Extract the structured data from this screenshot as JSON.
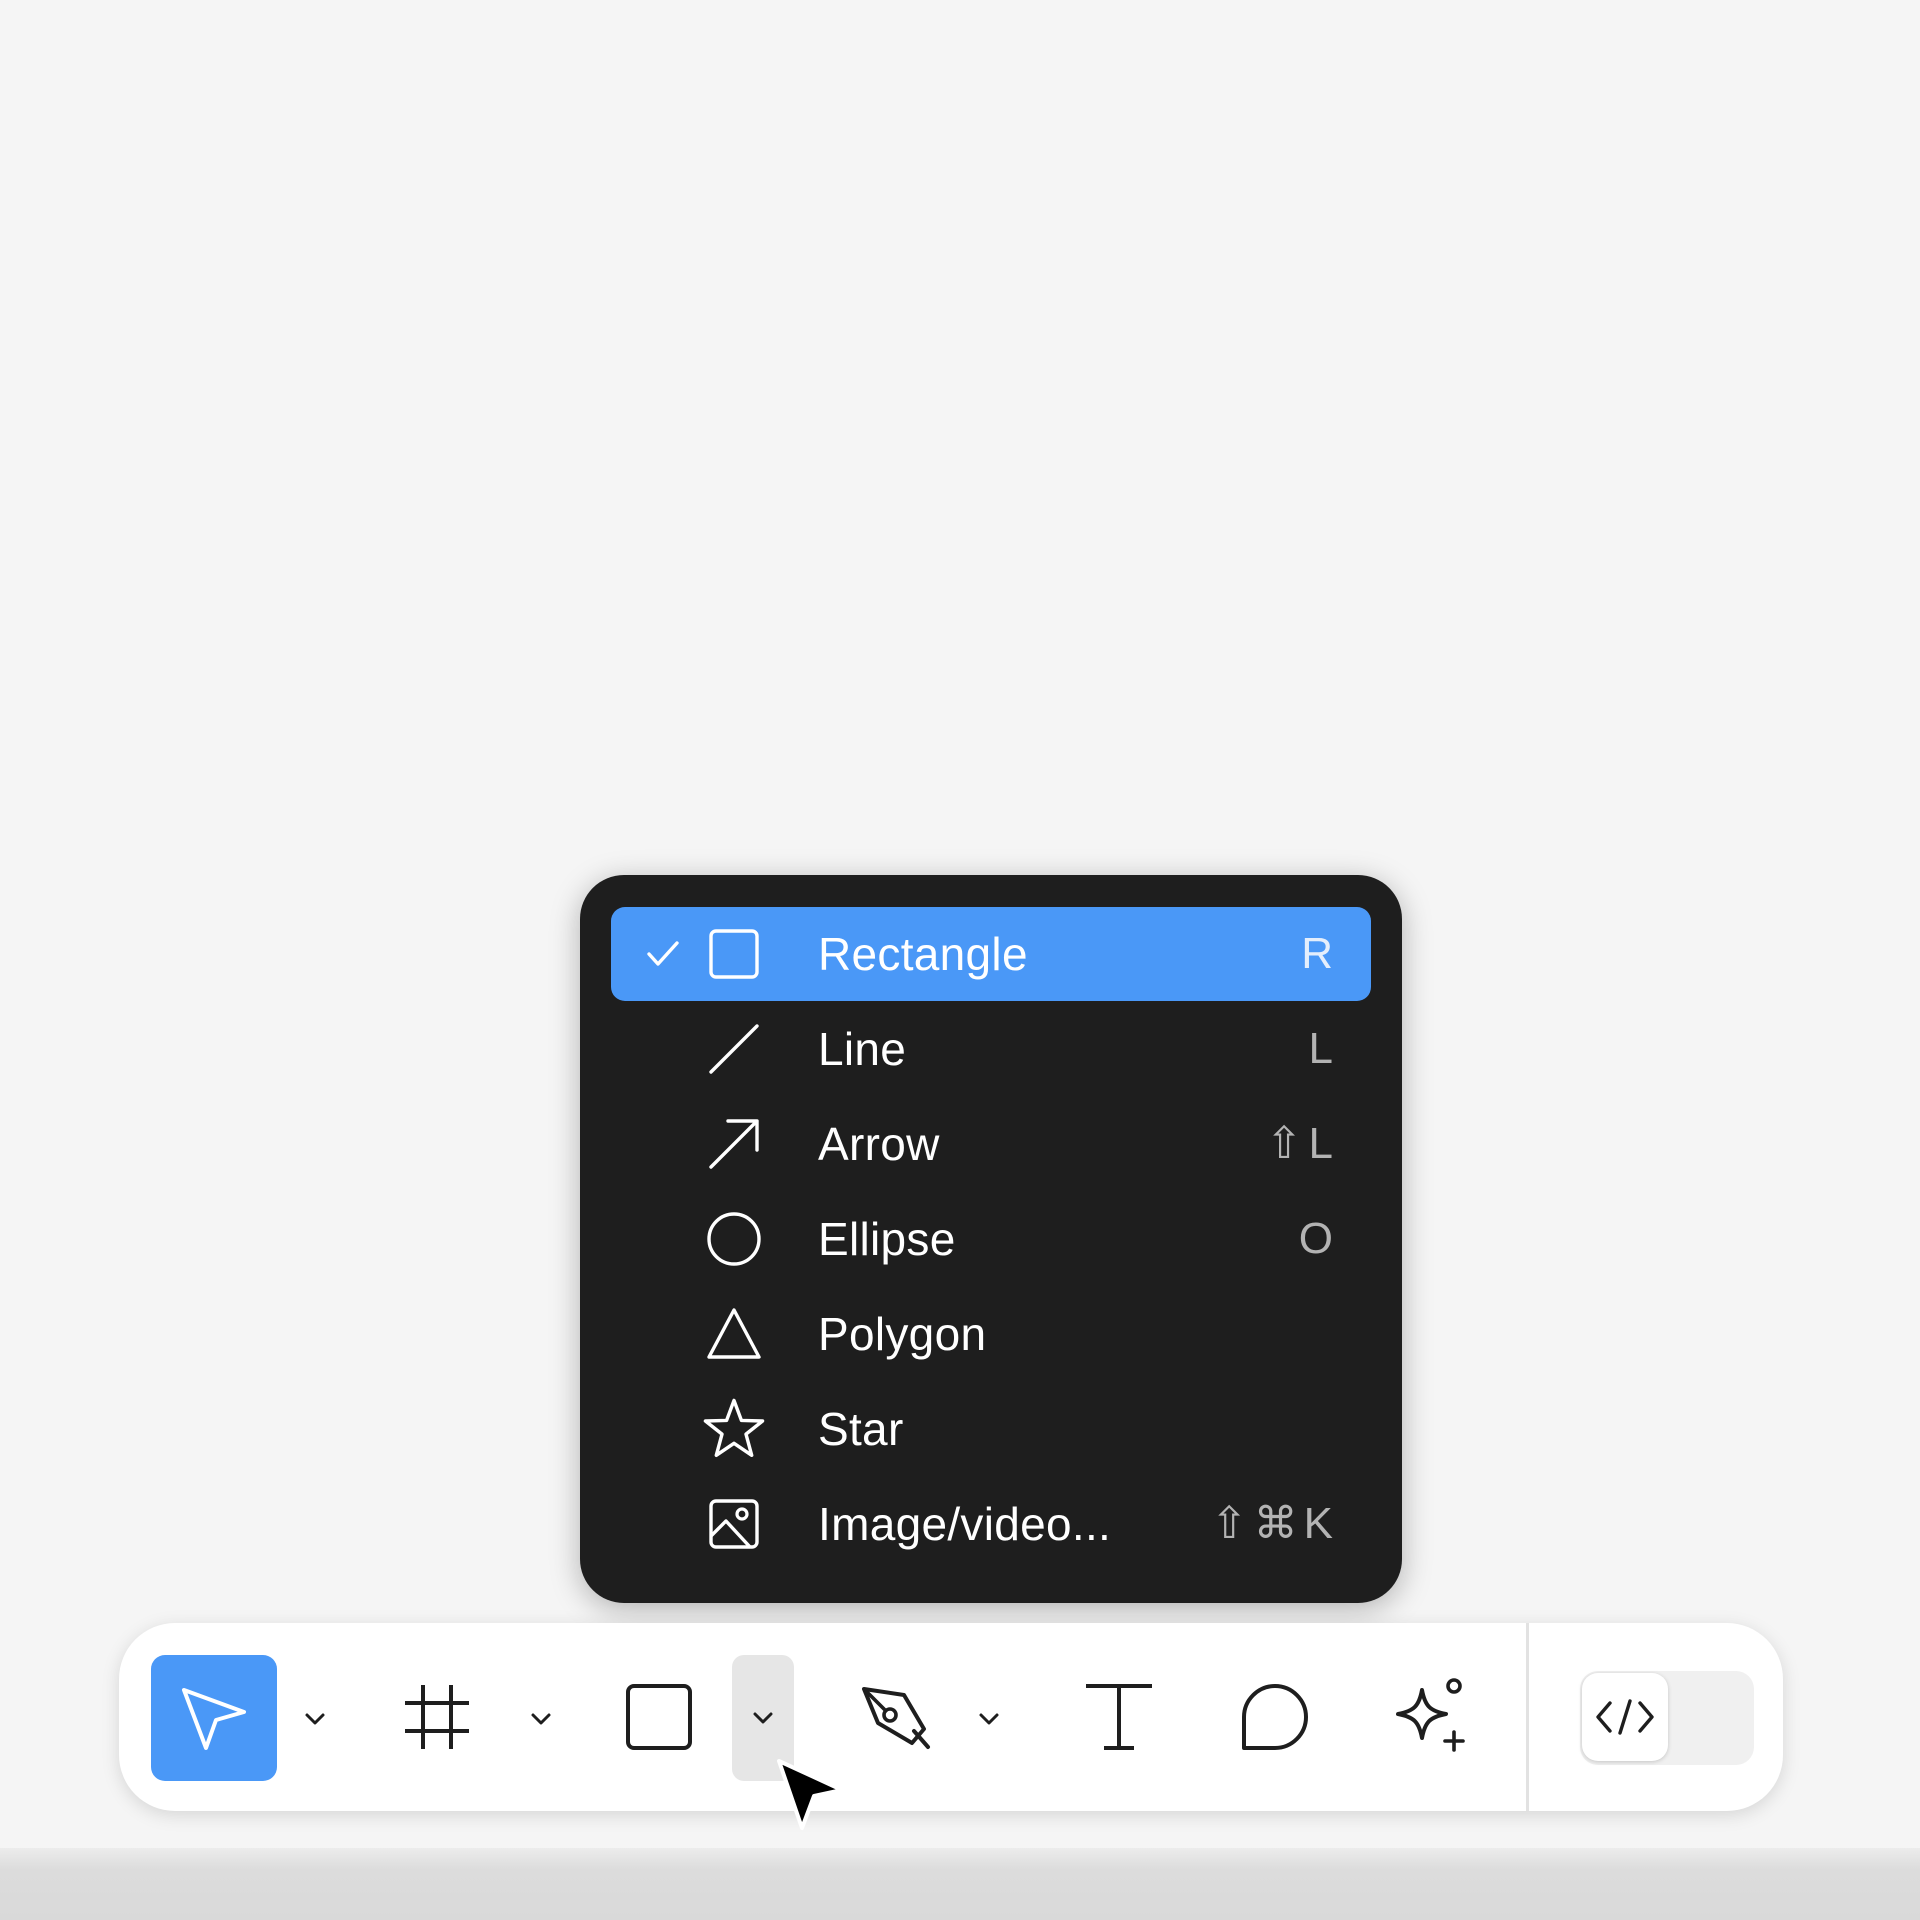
{
  "shape_menu": {
    "items": [
      {
        "label": "Rectangle",
        "shortcut": "R",
        "icon": "rectangle-icon",
        "selected": true
      },
      {
        "label": "Line",
        "shortcut": "L",
        "icon": "line-icon",
        "selected": false
      },
      {
        "label": "Arrow",
        "shortcut": "⇧L",
        "icon": "arrow-icon",
        "selected": false
      },
      {
        "label": "Ellipse",
        "shortcut": "O",
        "icon": "ellipse-icon",
        "selected": false
      },
      {
        "label": "Polygon",
        "shortcut": "",
        "icon": "polygon-icon",
        "selected": false
      },
      {
        "label": "Star",
        "shortcut": "",
        "icon": "star-icon",
        "selected": false
      },
      {
        "label": "Image/video...",
        "shortcut": "⇧⌘K",
        "icon": "image-icon",
        "selected": false
      }
    ]
  },
  "toolbar": {
    "tools": [
      "move",
      "frame",
      "rectangle",
      "pen",
      "text",
      "comment",
      "actions"
    ],
    "active_tool": "move",
    "open_dropdown": "rectangle",
    "dev_mode_on": false
  },
  "colors": {
    "accent": "#4a98f7",
    "menu_bg": "#1e1e1e",
    "canvas_bg": "#f5f5f5",
    "toolbar_bg": "#ffffff"
  }
}
